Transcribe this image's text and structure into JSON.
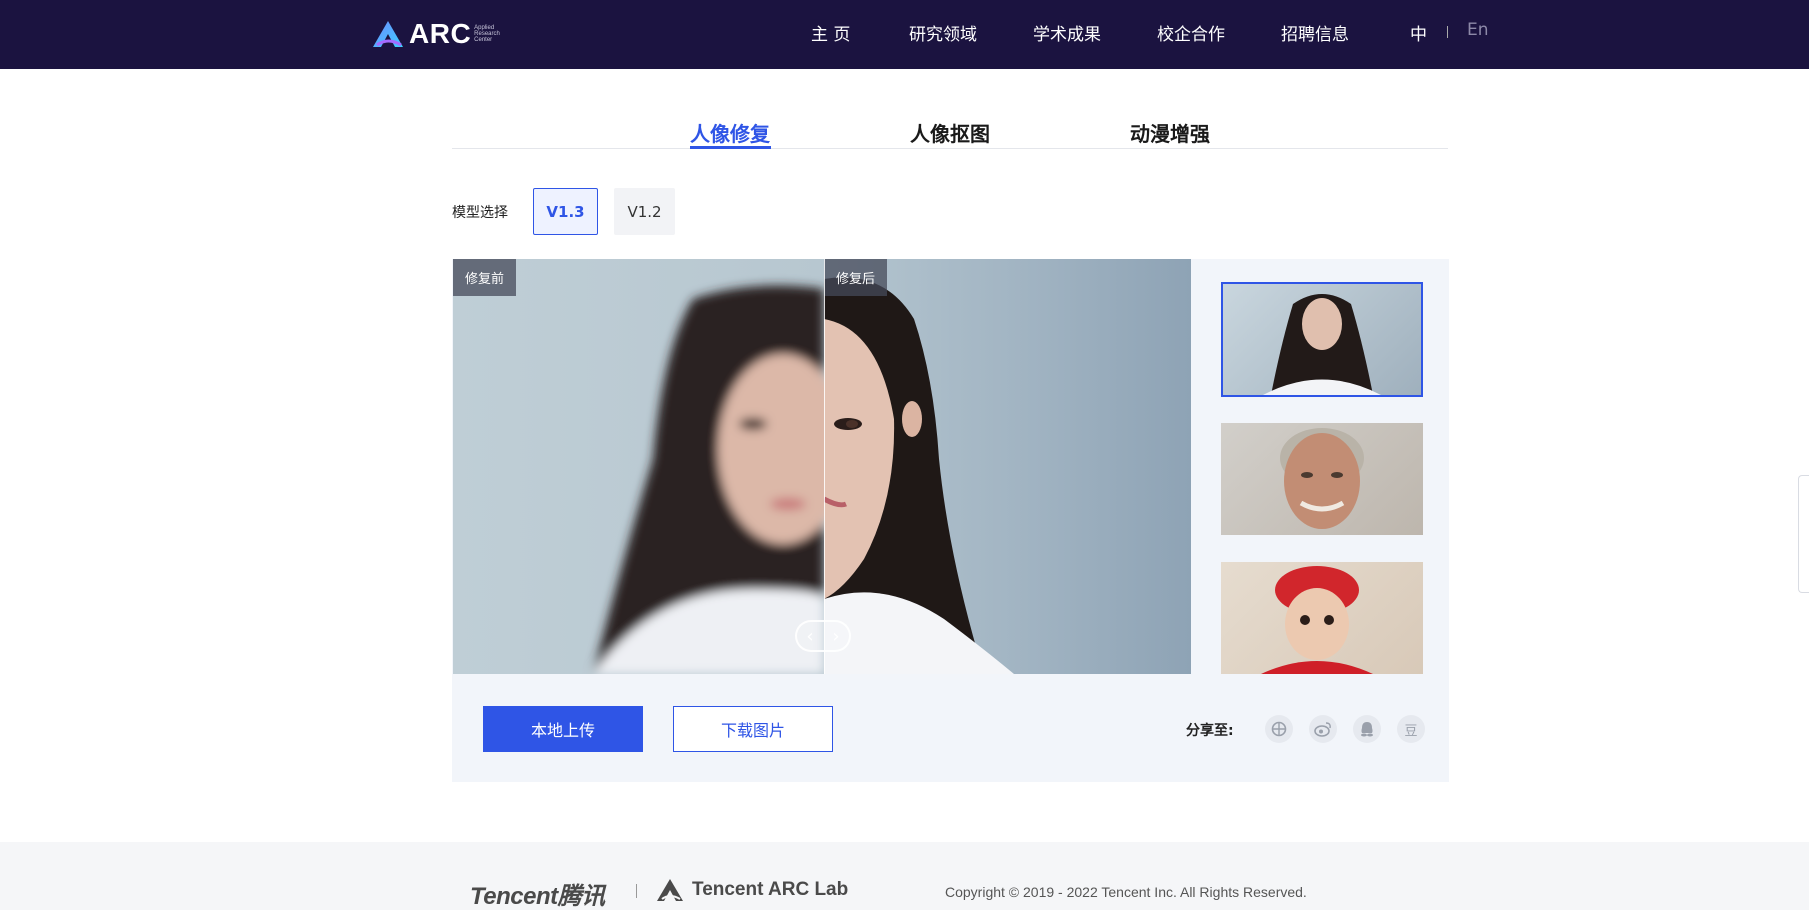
{
  "header": {
    "logo_text": "ARC",
    "logo_sub": [
      "Applied",
      "Research",
      "Center"
    ],
    "nav": [
      "主 页",
      "研究领域",
      "学术成果",
      "校企合作",
      "招聘信息"
    ],
    "lang_zh": "中",
    "lang_en": "En"
  },
  "tabs": [
    "人像修复",
    "人像抠图",
    "动漫增强"
  ],
  "model": {
    "label": "模型选择",
    "options": [
      "V1.3",
      "V1.2"
    ],
    "selected": "V1.3"
  },
  "viewer": {
    "before_label": "修复前",
    "after_label": "修复后",
    "handle_left": "‹",
    "handle_right": "›"
  },
  "actions": {
    "upload": "本地上传",
    "download": "下载图片",
    "share_label": "分享至:",
    "share_icons": [
      "moments-icon",
      "weibo-icon",
      "qq-icon",
      "douban-icon"
    ],
    "douban_glyph": "豆"
  },
  "footer": {
    "tencent": "Tencent腾讯",
    "arc_lab": "Tencent  ARC Lab",
    "copyright": "Copyright © 2019 - 2022 Tencent Inc. All Rights Reserved."
  },
  "colors": {
    "header_bg": "#1b1340",
    "accent": "#2f55e6",
    "panel_bg": "#f2f5fa"
  }
}
